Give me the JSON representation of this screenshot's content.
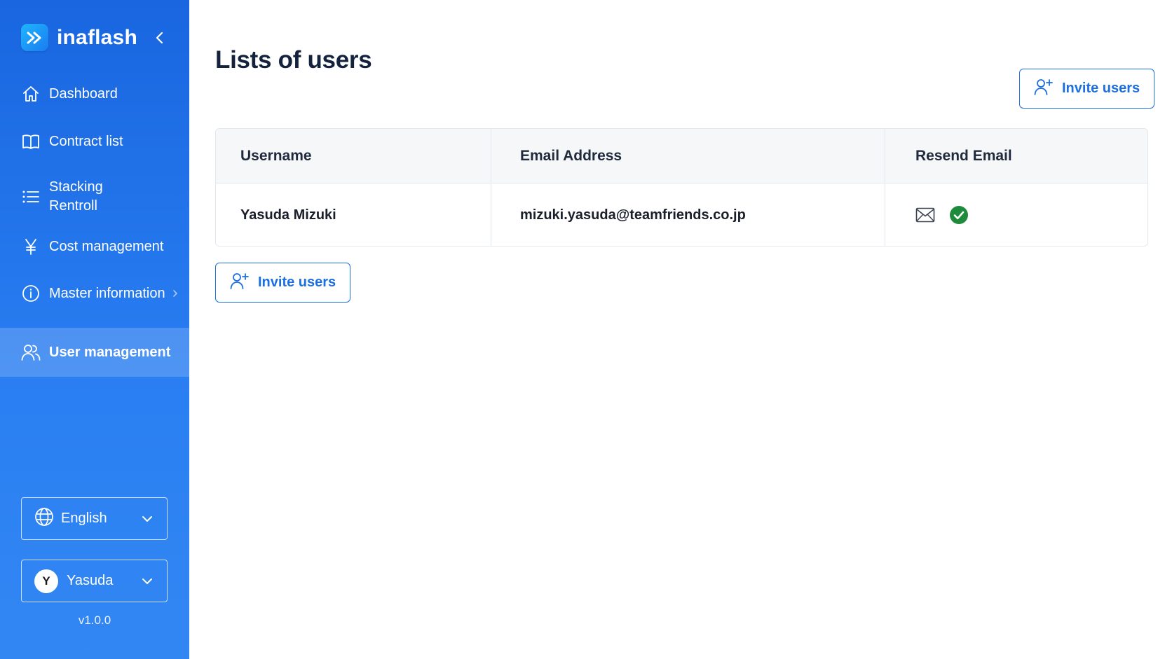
{
  "sidebar": {
    "brand": "inaflash",
    "items": [
      {
        "label": "Dashboard"
      },
      {
        "label": "Contract list"
      },
      {
        "label": "Stacking Rentroll",
        "line1": "Stacking",
        "line2": "Rentroll"
      },
      {
        "label": "Cost management"
      },
      {
        "label": "Master information"
      },
      {
        "label": "User management"
      }
    ],
    "language": "English",
    "user": {
      "initial": "Y",
      "name": "Yasuda"
    },
    "version": "v1.0.0"
  },
  "main": {
    "title": "Lists of users",
    "invite_label": "Invite users",
    "table": {
      "headers": [
        "Username",
        "Email Address",
        "Resend Email"
      ],
      "rows": [
        {
          "username": "Yasuda Mizuki",
          "email": "mizuki.yasuda@teamfriends.co.jp",
          "resend_status": "sent"
        }
      ]
    }
  },
  "colors": {
    "accent": "#1d6fe0",
    "sidebar_top": "#1966e0",
    "sidebar_bottom": "#3387f3",
    "success": "#1e8a3c",
    "title": "#14223d"
  }
}
